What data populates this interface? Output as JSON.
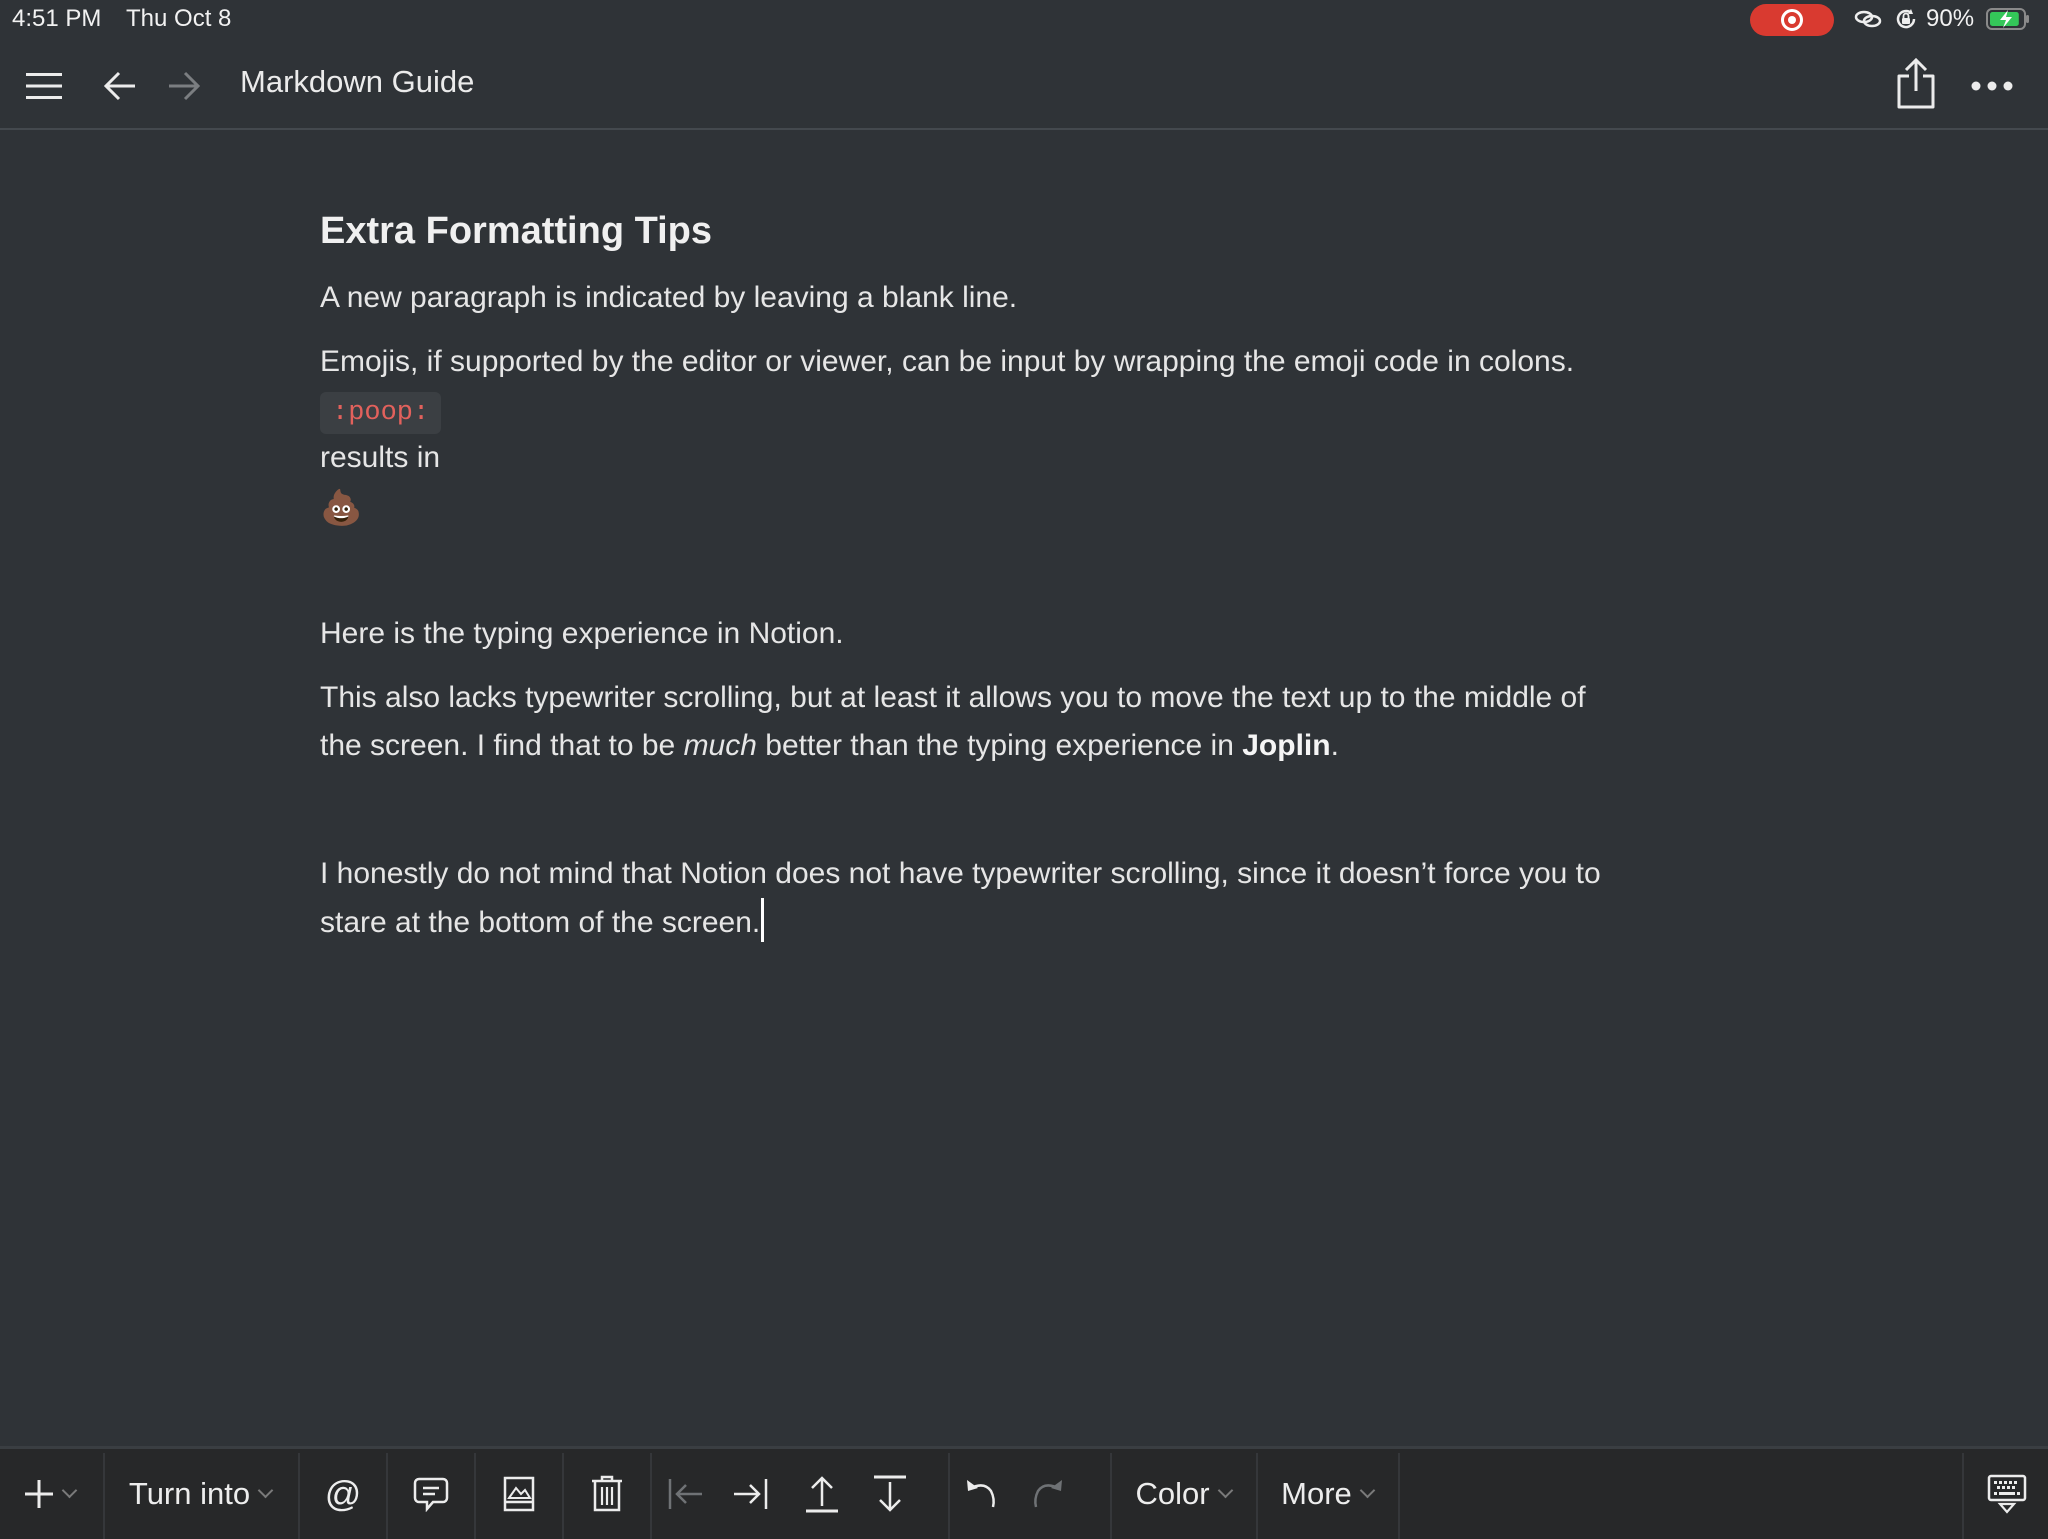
{
  "status_bar": {
    "time": "4:51 PM",
    "date": "Thu Oct 8",
    "recording_indicator": "screen-recording",
    "battery_percent": "90%",
    "battery_level": 0.9,
    "battery_charging": true,
    "colors": {
      "recording": "#d93a30",
      "battery": "#34c759"
    }
  },
  "nav": {
    "title": "Markdown Guide",
    "icons": [
      "menu-icon",
      "back-arrow-icon",
      "forward-arrow-icon",
      "share-icon",
      "more-icon"
    ]
  },
  "document": {
    "heading": "Extra Formatting Tips",
    "para_new_paragraph": "A new paragraph is indicated by leaving a blank line.",
    "para_emojis": "Emojis, if supported by the editor or viewer, can be input by wrapping the emoji code in colons.",
    "code_example": ":poop:",
    "results_in": "results in",
    "emoji_result": "💩",
    "para_typing": "Here is the typing experience in Notion.",
    "para_lacks_line1": "This also lacks typewriter scrolling, but at least it allows you to move the text up to the middle of",
    "para_lacks_line2_a": "the screen. I find that to be ",
    "para_lacks_line2_italic": "much",
    "para_lacks_line2_b": " better than the typing experience in ",
    "para_lacks_line2_bold": "Joplin",
    "para_lacks_line2_c": ".",
    "para_honest_line1": "I honestly do not mind that Notion does not have typewriter scrolling, since it doesn’t force you to",
    "para_honest_line2": "stare at the bottom of the screen."
  },
  "toolbar": {
    "add_icon": "plus-icon",
    "turn_into_label": "Turn into",
    "mention_label": "@",
    "color_label": "Color",
    "more_label": "More",
    "icons": [
      "comment-icon",
      "image-icon",
      "trash-icon",
      "outdent-icon",
      "indent-icon",
      "move-up-icon",
      "move-down-icon",
      "undo-icon",
      "redo-icon",
      "hide-keyboard-icon"
    ]
  }
}
